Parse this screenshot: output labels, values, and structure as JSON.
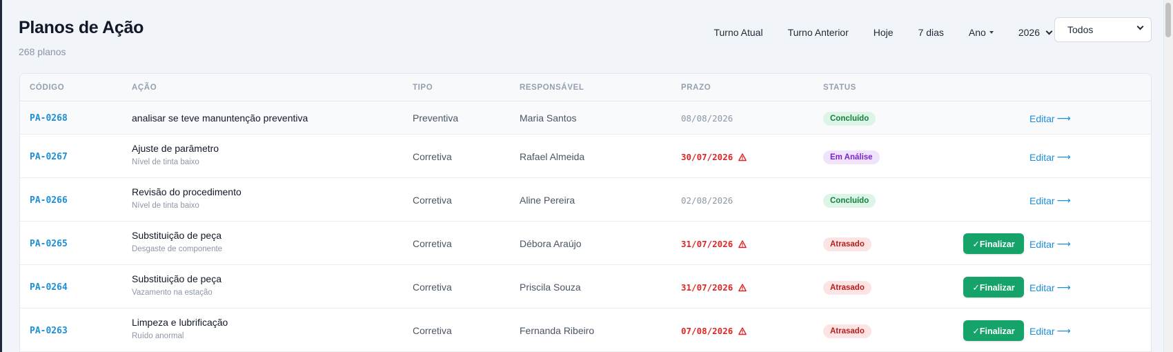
{
  "header": {
    "title": "Planos de Ação",
    "count": "268 planos"
  },
  "filters": {
    "buttons": [
      "Turno Atual",
      "Turno Anterior",
      "Hoje",
      "7 dias"
    ],
    "period": "Ano",
    "year": "2026",
    "status": "Todos"
  },
  "columns": [
    "CÓDIGO",
    "AÇÃO",
    "TIPO",
    "RESPONSÁVEL",
    "PRAZO",
    "STATUS"
  ],
  "actions": {
    "edit_label": "Editar",
    "edit_arrow": "⟶",
    "finalize_label": "✓Finalizar"
  },
  "rows": [
    {
      "code": "PA-0268",
      "title": "analisar se teve manuntenção preventiva",
      "subtitle": "",
      "type": "Preventiva",
      "owner": "Maria Santos",
      "deadline": "08/08/2026",
      "late": false,
      "status": "Concluído",
      "status_key": "done",
      "finalize": false
    },
    {
      "code": "PA-0267",
      "title": "Ajuste de parâmetro",
      "subtitle": "Nível de tinta baixo",
      "type": "Corretiva",
      "owner": "Rafael Almeida",
      "deadline": "30/07/2026",
      "late": true,
      "status": "Em Análise",
      "status_key": "review",
      "finalize": false
    },
    {
      "code": "PA-0266",
      "title": "Revisão do procedimento",
      "subtitle": "Nível de tinta baixo",
      "type": "Corretiva",
      "owner": "Aline Pereira",
      "deadline": "02/08/2026",
      "late": false,
      "status": "Concluído",
      "status_key": "done",
      "finalize": false
    },
    {
      "code": "PA-0265",
      "title": "Substituição de peça",
      "subtitle": "Desgaste de componente",
      "type": "Corretiva",
      "owner": "Débora Araújo",
      "deadline": "31/07/2026",
      "late": true,
      "status": "Atrasado",
      "status_key": "late",
      "finalize": true
    },
    {
      "code": "PA-0264",
      "title": "Substituição de peça",
      "subtitle": "Vazamento na estação",
      "type": "Corretiva",
      "owner": "Priscila Souza",
      "deadline": "31/07/2026",
      "late": true,
      "status": "Atrasado",
      "status_key": "late",
      "finalize": true
    },
    {
      "code": "PA-0263",
      "title": "Limpeza e lubrificação",
      "subtitle": "Ruído anormal",
      "type": "Corretiva",
      "owner": "Fernanda Ribeiro",
      "deadline": "07/08/2026",
      "late": true,
      "status": "Atrasado",
      "status_key": "late",
      "finalize": true
    }
  ],
  "colors": {
    "accent": "#1c8fd6",
    "late_text": "#dc2626",
    "done_bg": "#dcf5e6",
    "done_fg": "#15803d",
    "review_bg": "#efe4fb",
    "review_fg": "#7e22ce",
    "late_bg": "#fde4e4",
    "late_fg": "#b91c1c",
    "finalize_bg": "#16a36a"
  }
}
